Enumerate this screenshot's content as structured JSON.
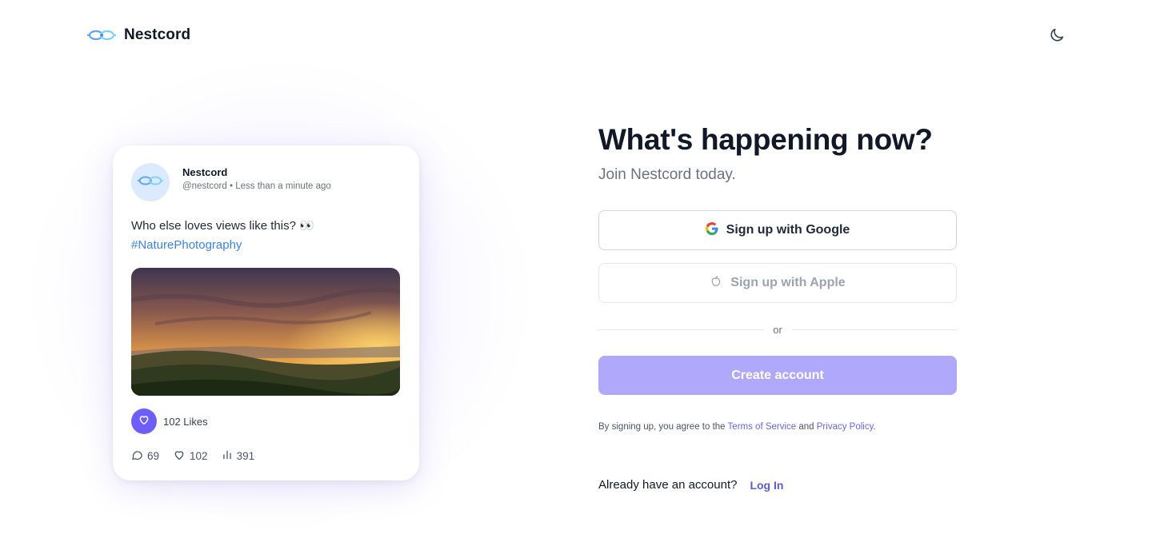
{
  "brand": {
    "name": "Nestcord"
  },
  "header": {
    "theme_icon": "moon-icon"
  },
  "post": {
    "author_name": "Nestcord",
    "handle": "@nestcord",
    "separator": "•",
    "time": "Less than a minute ago",
    "text": "Who else loves views like this? 👀",
    "hashtag": "#NaturePhotography",
    "image_subject": "sunset over hills",
    "likes_label": "102 Likes",
    "comments": "69",
    "likes": "102",
    "views": "391"
  },
  "signup": {
    "headline": "What's happening now?",
    "subheadline": "Join Nestcord today.",
    "google_label": "Sign up with Google",
    "apple_label": "Sign up with Apple",
    "divider": "or",
    "create_label": "Create account",
    "terms_prefix": "By signing up, you agree to the ",
    "terms_link": "Terms of Service",
    "terms_and": " and ",
    "privacy_link": "Privacy Policy",
    "terms_suffix": ".",
    "login_prompt": "Already have an account?",
    "login_link": "Log In"
  },
  "colors": {
    "accent": "#6d5dfc",
    "create_button": "#b0a8fb",
    "link": "#6366f1",
    "hashtag": "#3b82f6"
  }
}
